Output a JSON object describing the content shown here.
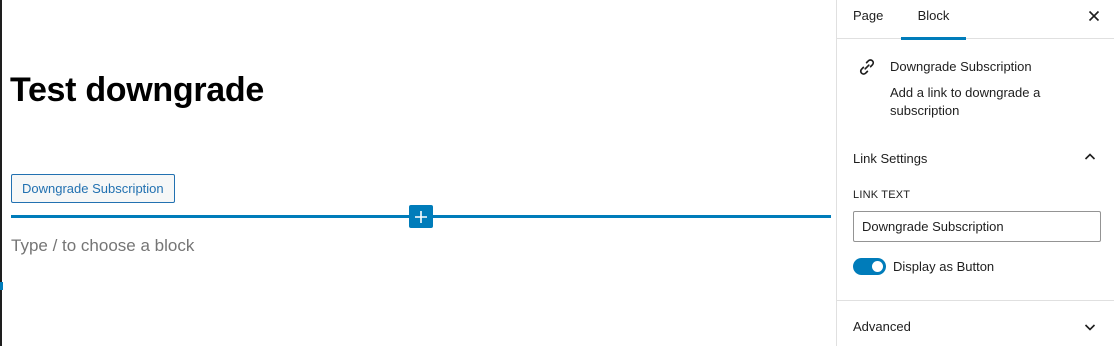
{
  "editor": {
    "page_title": "Test downgrade",
    "button_text": "Downgrade Subscription",
    "appender_placeholder": "Type / to choose a block",
    "inserter_icon": "plus-icon"
  },
  "sidebar": {
    "tabs": [
      {
        "label": "Page",
        "active": false
      },
      {
        "label": "Block",
        "active": true
      }
    ],
    "close_icon": "close-icon",
    "block_card": {
      "icon": "link-icon",
      "title": "Downgrade Subscription",
      "description": "Add a link to downgrade a subscription"
    },
    "link_settings": {
      "title": "Link Settings",
      "expanded": true,
      "link_text_label": "LINK TEXT",
      "link_text_value": "Downgrade Subscription",
      "display_as_button_label": "Display as Button",
      "display_as_button": true
    },
    "advanced": {
      "title": "Advanced",
      "expanded": false
    }
  },
  "colors": {
    "accent": "#007cba",
    "button_text": "#2271b1",
    "placeholder": "#757575",
    "border": "#e0e0e0"
  }
}
